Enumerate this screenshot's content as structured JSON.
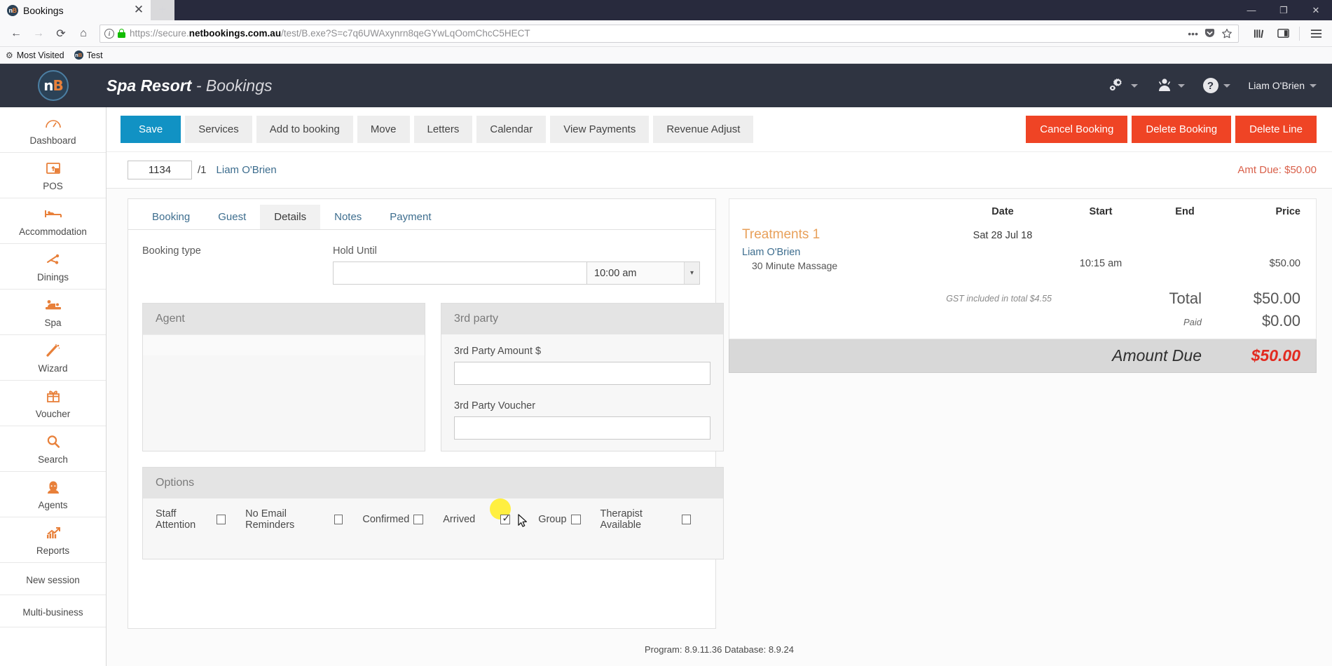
{
  "browser": {
    "tab": {
      "title": "Bookings",
      "favicon": "nb-favicon",
      "close": "✕"
    },
    "newtab_label": "+",
    "window_controls": {
      "minimize": "―",
      "maximize": "❐",
      "close": "✕"
    },
    "nav": {
      "back": "←",
      "forward": "→",
      "reload": "⟳",
      "home": "⌂"
    },
    "url": {
      "scheme": "https://secure.",
      "domain": "netbookings.com.au",
      "path": "/test/B.exe?S=c7q6UWAxynrn8qeGYwLqOomChcC5HECT",
      "full": "https://secure.netbookings.com.au/test/B.exe?S=c7q6UWAxynrn8qeGYwLqOomChcC5HECT"
    },
    "urlbar_icons": [
      "page-info-icon",
      "lock-icon",
      "ellipsis-icon",
      "pocket-icon",
      "star-bookmark-icon"
    ],
    "toolbar_icons": [
      "library-icon",
      "sidebar-icon",
      "hamburger-menu-icon"
    ],
    "bookmarks": [
      {
        "label": "Most Visited",
        "icon": "gear-icon"
      },
      {
        "label": "Test",
        "icon": "nb-favicon"
      }
    ]
  },
  "app": {
    "logo": {
      "n": "n",
      "b": "B"
    },
    "title_main": "Spa Resort",
    "title_sep": " - ",
    "title_sub": "Bookings",
    "header_actions": [
      {
        "name": "settings",
        "icon": "gears-icon"
      },
      {
        "name": "user",
        "icon": "person-icon"
      },
      {
        "name": "help",
        "icon": "question-circle-icon",
        "glyph": "?"
      }
    ],
    "user_name": "Liam O'Brien"
  },
  "sidebar": {
    "items": [
      {
        "label": "Dashboard",
        "icon": "dashboard-gauge-icon"
      },
      {
        "label": "POS",
        "icon": "pos-terminal-icon"
      },
      {
        "label": "Accommodation",
        "icon": "bed-icon"
      },
      {
        "label": "Dinings",
        "icon": "dining-fork-icon"
      },
      {
        "label": "Spa",
        "icon": "spa-massage-icon"
      },
      {
        "label": "Wizard",
        "icon": "magic-wand-icon"
      },
      {
        "label": "Voucher",
        "icon": "gift-icon"
      },
      {
        "label": "Search",
        "icon": "magnifier-icon"
      },
      {
        "label": "Agents",
        "icon": "agent-person-icon"
      },
      {
        "label": "Reports",
        "icon": "chart-growth-icon"
      }
    ],
    "plain_items": [
      {
        "label": "New session"
      },
      {
        "label": "Multi-business"
      }
    ]
  },
  "toolbar": {
    "buttons": [
      {
        "label": "Save",
        "style": "primary"
      },
      {
        "label": "Services",
        "style": "default"
      },
      {
        "label": "Add to booking",
        "style": "default"
      },
      {
        "label": "Move",
        "style": "default"
      },
      {
        "label": "Letters",
        "style": "default"
      },
      {
        "label": "Calendar",
        "style": "default"
      },
      {
        "label": "View Payments",
        "style": "default"
      },
      {
        "label": "Revenue Adjust",
        "style": "default"
      }
    ],
    "danger_buttons": [
      {
        "label": "Cancel Booking"
      },
      {
        "label": "Delete Booking"
      },
      {
        "label": "Delete Line"
      }
    ]
  },
  "idbar": {
    "booking_id": "1134",
    "line_suffix": "/1",
    "guest_name": "Liam O'Brien",
    "amt_due": "Amt Due: $50.00"
  },
  "tabs": [
    {
      "label": "Booking",
      "active": false
    },
    {
      "label": "Guest",
      "active": false
    },
    {
      "label": "Details",
      "active": true
    },
    {
      "label": "Notes",
      "active": false
    },
    {
      "label": "Payment",
      "active": false
    }
  ],
  "details": {
    "booking_type_label": "Booking type",
    "booking_type_value": "",
    "hold_until_label": "Hold Until",
    "hold_until_value": "",
    "hold_until_time": "10:00 am",
    "agent": {
      "title": "Agent",
      "value": ""
    },
    "third_party": {
      "title": "3rd party",
      "amount_label": "3rd Party Amount $",
      "amount_value": "",
      "voucher_label": "3rd Party Voucher",
      "voucher_value": ""
    },
    "options": {
      "title": "Options",
      "checkboxes": [
        {
          "label": "Staff Attention",
          "checked": false,
          "highlighted": false
        },
        {
          "label": "No Email Reminders",
          "checked": false,
          "highlighted": false
        },
        {
          "label": "Confirmed",
          "checked": false,
          "highlighted": false
        },
        {
          "label": "Arrived",
          "checked": true,
          "highlighted": true
        },
        {
          "label": "Group",
          "checked": false,
          "highlighted": false
        },
        {
          "label": "Therapist Available",
          "checked": false,
          "highlighted": false
        }
      ]
    }
  },
  "summary": {
    "columns": {
      "date": "Date",
      "start": "Start",
      "end": "End",
      "price": "Price"
    },
    "group": {
      "name": "Treatments 1",
      "date": "Sat 28 Jul 18"
    },
    "line": {
      "guest": "Liam O'Brien",
      "service": "30 Minute Massage",
      "start": "10:15 am",
      "end": "",
      "price": "$50.00"
    },
    "gst_note": "GST included in total $4.55",
    "total_label": "Total",
    "total_value": "$50.00",
    "paid_label": "Paid",
    "paid_value": "$0.00",
    "due_label": "Amount Due",
    "due_value": "$50.00"
  },
  "footer": {
    "version": "Program: 8.9.11.36 Database: 8.9.24"
  },
  "colors": {
    "accent_blue": "#1192c4",
    "danger_red": "#ef4425",
    "brand_orange": "#e8803a",
    "header_dark": "#2f3441",
    "due_red": "#e22a20",
    "highlight_yellow": "#ffef40"
  }
}
